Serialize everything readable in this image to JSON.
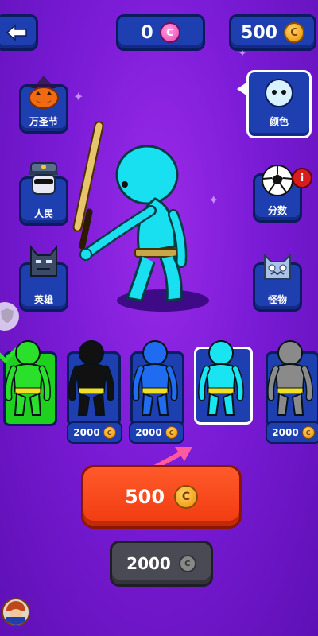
{
  "top_bar": {
    "back_icon": "back-arrow-icon",
    "gems": {
      "value": "0",
      "icon": "gem-icon",
      "color": "#f060c0"
    },
    "coins": {
      "value": "500",
      "icon": "coin-icon",
      "color": "#f4a21b"
    }
  },
  "categories_left": [
    {
      "label": "万圣节",
      "icon": "pumpkin-icon"
    },
    {
      "label": "人民",
      "icon": "police-icon"
    },
    {
      "label": "英雄",
      "icon": "bat-mask-icon"
    }
  ],
  "categories_right": [
    {
      "label": "颜色",
      "icon": "face-icon",
      "selected": true
    },
    {
      "label": "分数",
      "icon": "soccer-ball-icon",
      "badge": "i"
    },
    {
      "label": "怪物",
      "icon": "monster-icon"
    }
  ],
  "skins": [
    {
      "color": "#2be02b",
      "price": "",
      "selected": false,
      "bg": "#1fd11f"
    },
    {
      "color": "#111111",
      "price": "2000",
      "selected": false,
      "bg": "#1e3fb0"
    },
    {
      "color": "#1f6cf0",
      "price": "2000",
      "selected": false,
      "bg": "#1e3fb0"
    },
    {
      "color": "#19e5f2",
      "price": "",
      "selected": true,
      "bg": "#1e3fb0"
    },
    {
      "color": "#8a8a8a",
      "price": "2000",
      "selected": false,
      "bg": "#1e3fb0"
    }
  ],
  "buy_button": {
    "label": "500",
    "icon": "coin-icon"
  },
  "secondary_button": {
    "label": "2000",
    "icon": "coin-icon"
  },
  "coin_symbol": "C"
}
